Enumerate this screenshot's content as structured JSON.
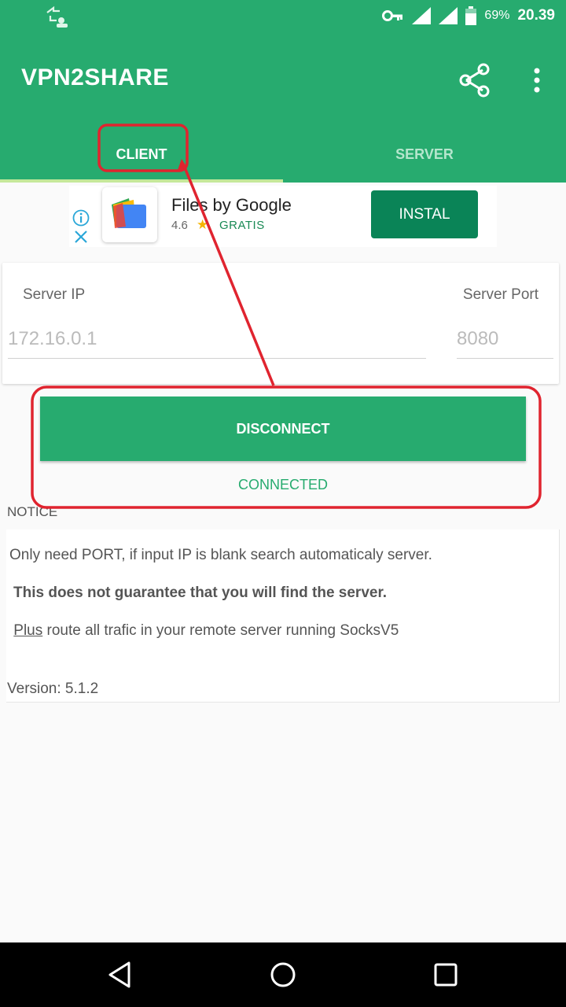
{
  "status_bar": {
    "battery": "69%",
    "time": "20.39"
  },
  "app_bar": {
    "title": "VPN2SHARE",
    "icons": [
      "share-icon",
      "more-vert-icon"
    ]
  },
  "tabs": [
    {
      "label": "CLIENT",
      "selected": true
    },
    {
      "label": "SERVER",
      "selected": false
    }
  ],
  "ad": {
    "app_name": "Files by Google",
    "rating": "4.6",
    "price": "GRATIS",
    "install_label": "INSTAL"
  },
  "form": {
    "server_ip_label": "Server IP",
    "server_ip_placeholder": "172.16.0.1",
    "server_port_label": "Server Port",
    "server_port_placeholder": "8080"
  },
  "actions": {
    "disconnect_label": "DISCONNECT",
    "status_text": "CONNECTED"
  },
  "notice": {
    "label": "NOTICE",
    "line1": "Only need PORT, if input IP is blank search automaticaly server.",
    "line2": "This does not guarantee that you will find the server.",
    "line3_link": "Plus",
    "line3_rest": " route all trafic in your remote server running SocksV5",
    "version": "Version: 5.1.2"
  },
  "colors": {
    "primary": "#27ab6f",
    "install_button": "#0a8457",
    "annotation": "#e0242f"
  }
}
